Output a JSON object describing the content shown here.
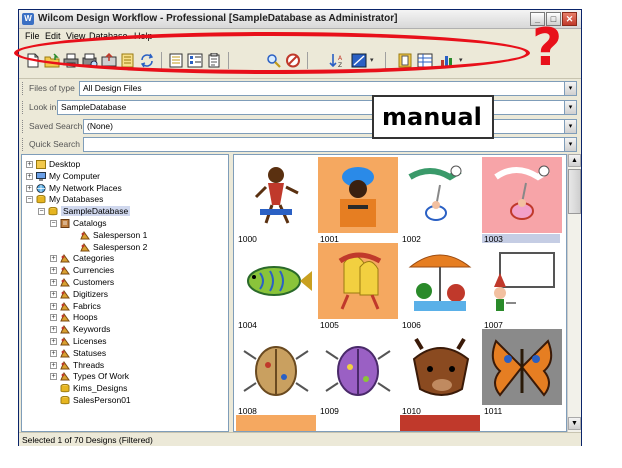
{
  "window": {
    "title": "Wilcom Design Workflow - Professional  [SampleDatabase as Administrator]",
    "app_icon_glyph": "W",
    "min_glyph": "_",
    "max_glyph": "□",
    "close_glyph": "✕"
  },
  "menu": {
    "items": [
      "File",
      "Edit",
      "View",
      "Database",
      "Help"
    ]
  },
  "toolbar": {
    "buttons": [
      "new-icon",
      "open-folder-icon",
      "print-icon",
      "print-preview-icon",
      "export-icon",
      "stitch-icon",
      "refresh-icon",
      "details-view-icon",
      "list-view-icon",
      "properties-icon",
      "search-icon",
      "stop-search-icon",
      "sort-icon",
      "thumbnail-size-icon",
      "report-icon",
      "table-icon",
      "chart-icon"
    ],
    "dropdown_glyph": "▾"
  },
  "filters": {
    "files_of_type": {
      "label": "Files of type",
      "value": "All Design Files"
    },
    "look_in": {
      "label": "Look in",
      "value": "SampleDatabase"
    },
    "saved_search": {
      "label": "Saved Search",
      "value": "(None)"
    },
    "quick_search": {
      "label": "Quick Search",
      "value": ""
    },
    "drop_glyph": "▾"
  },
  "tree": {
    "items": [
      {
        "label": "Desktop",
        "exp": "+"
      },
      {
        "label": "My Computer",
        "exp": "+"
      },
      {
        "label": "My Network Places",
        "exp": "+"
      },
      {
        "label": "My Databases",
        "exp": "−"
      },
      {
        "label": "SampleDatabase",
        "exp": "−"
      },
      {
        "label": "Catalogs",
        "exp": "−"
      },
      {
        "label": "Salesperson 1",
        "exp": ""
      },
      {
        "label": "Salesperson 2",
        "exp": ""
      },
      {
        "label": "Categories",
        "exp": "+"
      },
      {
        "label": "Currencies",
        "exp": "+"
      },
      {
        "label": "Customers",
        "exp": "+"
      },
      {
        "label": "Digitizers",
        "exp": "+"
      },
      {
        "label": "Fabrics",
        "exp": "+"
      },
      {
        "label": "Hoops",
        "exp": "+"
      },
      {
        "label": "Keywords",
        "exp": "+"
      },
      {
        "label": "Licenses",
        "exp": "+"
      },
      {
        "label": "Statuses",
        "exp": "+"
      },
      {
        "label": "Threads",
        "exp": "+"
      },
      {
        "label": "Types Of Work",
        "exp": "+"
      },
      {
        "label": "Kims_Designs",
        "exp": ""
      },
      {
        "label": "SalesPerson01",
        "exp": ""
      }
    ]
  },
  "designs": [
    {
      "id": "1000",
      "bg": "#ffffff",
      "subject": "African dancer"
    },
    {
      "id": "1001",
      "bg": "#f5a860",
      "subject": "Turbaned man"
    },
    {
      "id": "1002",
      "bg": "#ffffff",
      "subject": "Stork with baby"
    },
    {
      "id": "1003",
      "bg": "#f7a4a8",
      "subject": "Stork with baby pink"
    },
    {
      "id": "1004",
      "bg": "#ffffff",
      "subject": "Fish"
    },
    {
      "id": "1005",
      "bg": "#f5a860",
      "subject": "Bells"
    },
    {
      "id": "1006",
      "bg": "#ffffff",
      "subject": "Garden umbrella"
    },
    {
      "id": "1007",
      "bg": "#ffffff",
      "subject": "Gnome with sign"
    },
    {
      "id": "1008",
      "bg": "#ffffff",
      "subject": "Beetle"
    },
    {
      "id": "1009",
      "bg": "#ffffff",
      "subject": "Beetle purple"
    },
    {
      "id": "1010",
      "bg": "#ffffff",
      "subject": "Boar head"
    },
    {
      "id": "1011",
      "bg": "#8a8a8a",
      "subject": "Butterfly"
    }
  ],
  "status": {
    "text": "Selected 1 of 70 Designs (Filtered)"
  },
  "annotations": {
    "manual_label": "manual",
    "question_mark": "?",
    "color": "#e8101a"
  },
  "colors": {
    "selection": "#c5cde4",
    "window_bg": "#ece9d8"
  }
}
